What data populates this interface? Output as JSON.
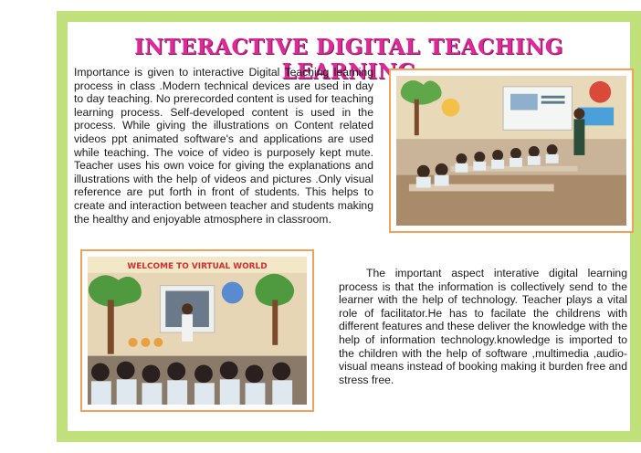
{
  "title": "INTERACTIVE DIGITAL TEACHING LEARNING",
  "paragraph1": "Importance is given to interactive Digital Teaching learning process in class .Modern technical devices are used in day to day teaching. No prerecorded content is used for teaching learning process. Self-developed content is used in the process. While giving the illustrations on Content related videos ppt animated software's and applications are used while teaching. The voice of video is purposely kept mute. Teacher uses his own voice for giving the explanations and illustrations with the help of videos and pictures .Only visual reference are put forth in front of students. This helps to create and interaction between teacher and students making the healthy and enjoyable atmosphere in classroom.",
  "paragraph2": "The important aspect interative digital learning process is that the information is collectively send to the learner with the help of technology. Teacher plays a vital role of facilitator.He has to facilate the childrens with different features and these deliver the knowledge with the help of information technology.knowledge is imported to the children with the help of software ,multimedia ,audio-visual means instead of booking making it burden free and stress free.",
  "photo2_banner": "WELCOME TO VIRTUAL WORLD",
  "colors": {
    "frame": "#bfe07a",
    "title": "#e0289a",
    "photo_border": "#f0a25a"
  }
}
